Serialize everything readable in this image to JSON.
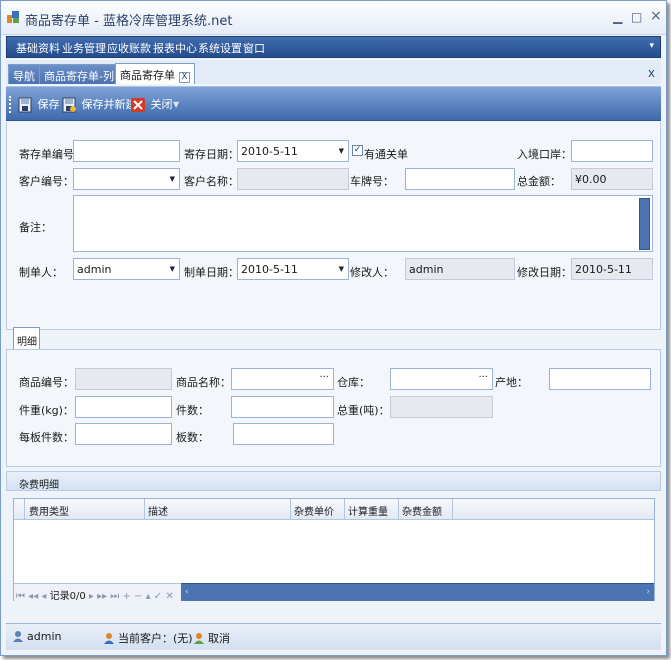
{
  "window": {
    "title": "商品寄存单 - 蓝格冷库管理系统.net",
    "min_glyph": "▁",
    "max_glyph": "□",
    "close_glyph": "×"
  },
  "menu": [
    "基础资料",
    "业务管理",
    "应收账款",
    "报表中心",
    "系统设置",
    "窗口"
  ],
  "menu_arrow": "▾",
  "tabs": [
    {
      "label": "导航"
    },
    {
      "label": "商品寄存单-列表"
    },
    {
      "label": "商品寄存单",
      "close": "X"
    }
  ],
  "tabstrip_close": "x",
  "toolbar": {
    "save": "保存",
    "save_new": "保存并新建",
    "close": "关闭"
  },
  "form": {
    "deposit_no": {
      "label": "寄存单编号：",
      "value": ""
    },
    "deposit_date": {
      "label": "寄存日期：",
      "value": "2010-5-11"
    },
    "customs": {
      "label": "有通关单",
      "checked": "✓"
    },
    "port": {
      "label": "入境口岸：",
      "value": ""
    },
    "customer_no": {
      "label": "客户编号：",
      "value": ""
    },
    "customer_name": {
      "label": "客户名称：",
      "value": ""
    },
    "plate": {
      "label": "车牌号：",
      "value": ""
    },
    "total": {
      "label": "总金额：",
      "value": "¥0.00"
    },
    "remark": {
      "label": "备注：",
      "value": ""
    },
    "maker": {
      "label": "制单人：",
      "value": "admin"
    },
    "make_date": {
      "label": "制单日期：",
      "value": "2010-5-11"
    },
    "modifier": {
      "label": "修改人：",
      "value": "admin"
    },
    "modify_date": {
      "label": "修改日期：",
      "value": "2010-5-11"
    }
  },
  "detail_tab": "明细",
  "detail": {
    "goods_no": {
      "label": "商品编号：",
      "value": ""
    },
    "goods_name": {
      "label": "商品名称：",
      "value": ""
    },
    "warehouse": {
      "label": "仓库：",
      "value": ""
    },
    "origin": {
      "label": "产地：",
      "value": ""
    },
    "piece_weight": {
      "label": "件重(kg)：",
      "value": ""
    },
    "pieces": {
      "label": "件数：",
      "value": ""
    },
    "total_weight": {
      "label": "总重(吨)：",
      "value": ""
    },
    "per_board": {
      "label": "每板件数：",
      "value": ""
    },
    "boards": {
      "label": "板数：",
      "value": ""
    }
  },
  "misc": {
    "title": "杂费明细",
    "columns": [
      "费用类型",
      "描述",
      "杂费单价",
      "计算重量",
      "杂费金额"
    ],
    "nav_left": "⏮ ◂◂ ◂",
    "record_text": "记录0/0",
    "nav_right": "▸ ▸▸ ⏭ + − ▴ ✓ ✕",
    "scroll_left": "‹",
    "scroll_right": "›"
  },
  "status": {
    "user": "admin",
    "current_customer": "当前客户：",
    "customer_value": "(无)",
    "cancel": "取消"
  },
  "colors": {
    "menubar": "#2b5597",
    "toolbar": "#5a82c2",
    "accent_red": "#d23a2a"
  }
}
